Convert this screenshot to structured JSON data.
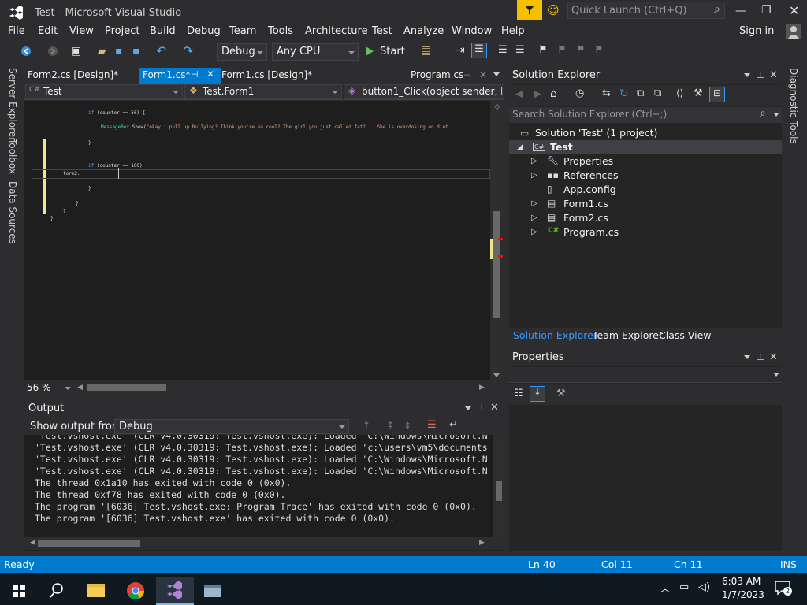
{
  "window": {
    "title": "Test - Microsoft Visual Studio",
    "quick_launch_placeholder": "Quick Launch (Ctrl+Q)",
    "sign_in": "Sign in"
  },
  "menu": [
    "File",
    "Edit",
    "View",
    "Project",
    "Build",
    "Debug",
    "Team",
    "Tools",
    "Architecture",
    "Test",
    "Analyze",
    "Window",
    "Help"
  ],
  "toolbar": {
    "config": "Debug",
    "platform": "Any CPU",
    "start": "Start"
  },
  "left_tabs": [
    "Server Explorer",
    "Toolbox",
    "Data Sources"
  ],
  "doc_tabs": [
    {
      "label": "Form2.cs [Design]*"
    },
    {
      "label": "Form1.cs*"
    },
    {
      "label": "Form1.cs [Design]*"
    },
    {
      "label": "Program.cs"
    }
  ],
  "navbar": {
    "project": "Test",
    "class": "Test.Form1",
    "member": "button1_Click(object sender, Ev"
  },
  "code": {
    "line1_kw": "if",
    "line1_rest": "(counter == 50) {",
    "line2_type": "MessageBox",
    "line2_method": ".Show(",
    "line2_str": "\"okay i pull up Bullying? Think you're so cool? The girl you just called fat?... She is overdosing on diet",
    "line3": "}",
    "line4_kw": "if",
    "line4_rest": "(counter == 100)",
    "line5": "form2.",
    "brace_a": "}",
    "brace_b": "}",
    "brace_c": "}",
    "brace_d": "}"
  },
  "editor": {
    "zoom": "56 %"
  },
  "output": {
    "title": "Output",
    "show_from_label": "Show output from:",
    "source": "Debug",
    "lines": [
      "'Test.vshost.exe' (CLR v4.0.30319: Test.vshost.exe): Loaded 'C:\\Windows\\Microsoft.N",
      "'Test.vshost.exe' (CLR v4.0.30319: Test.vshost.exe): Loaded 'c:\\users\\vm5\\documents",
      "'Test.vshost.exe' (CLR v4.0.30319: Test.vshost.exe): Loaded 'C:\\Windows\\Microsoft.N",
      "'Test.vshost.exe' (CLR v4.0.30319: Test.vshost.exe): Loaded 'C:\\Windows\\Microsoft.N",
      "The thread 0x1a10 has exited with code 0 (0x0).",
      "The thread 0xf78 has exited with code 0 (0x0).",
      "The program '[6036] Test.vshost.exe: Program Trace' has exited with code 0 (0x0).",
      "The program '[6036] Test.vshost.exe' has exited with code 0 (0x0)."
    ]
  },
  "solution_explorer": {
    "title": "Solution Explorer",
    "search_placeholder": "Search Solution Explorer (Ctrl+;)",
    "solution": "Solution 'Test' (1 project)",
    "project": "Test",
    "items": [
      "Properties",
      "References",
      "App.config",
      "Form1.cs",
      "Form2.cs",
      "Program.cs"
    ],
    "tabs": [
      "Solution Explorer",
      "Team Explorer",
      "Class View"
    ]
  },
  "properties": {
    "title": "Properties"
  },
  "right_tabs": [
    "Diagnostic Tools"
  ],
  "status": {
    "state": "Ready",
    "ln": "Ln 40",
    "col": "Col 11",
    "ch": "Ch 11",
    "mode": "INS"
  },
  "taskbar": {
    "time": "6:03 AM",
    "date": "1/7/2023",
    "notifications": "2"
  },
  "colors": {
    "accent": "#007acc",
    "background": "#2d2d30",
    "editor": "#1e1e1e"
  }
}
